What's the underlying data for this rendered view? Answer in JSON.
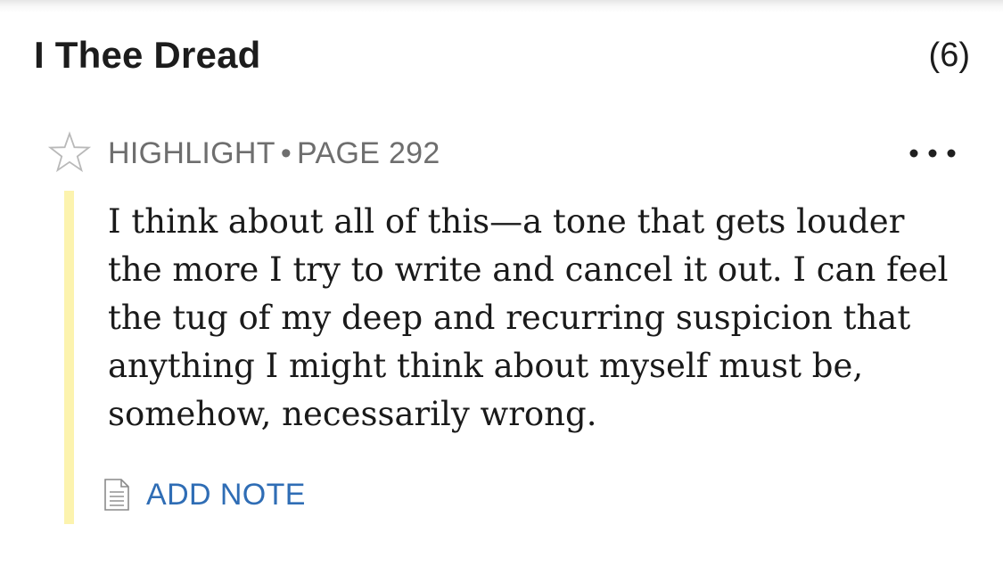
{
  "chapter": {
    "title": "I Thee Dread",
    "count": "(6)"
  },
  "annotation": {
    "type": "HIGHLIGHT",
    "separator": "•",
    "page": "PAGE 292",
    "text": "I think about all of this—a tone that gets louder the more I try to write and cancel it out. I can feel the tug of my deep and recurring suspicion that anything I might think about myself must be, somehow, necessarily wrong.",
    "highlight_color": "#fcf3ae",
    "add_note_label": "ADD NOTE",
    "icons": {
      "favorite": "star-outline-icon",
      "menu": "more-horizontal-icon",
      "note": "document-icon"
    }
  },
  "colors": {
    "accent": "#2f6db5",
    "meta_text": "#6e6e6e",
    "body_text": "#1a1a1a"
  }
}
